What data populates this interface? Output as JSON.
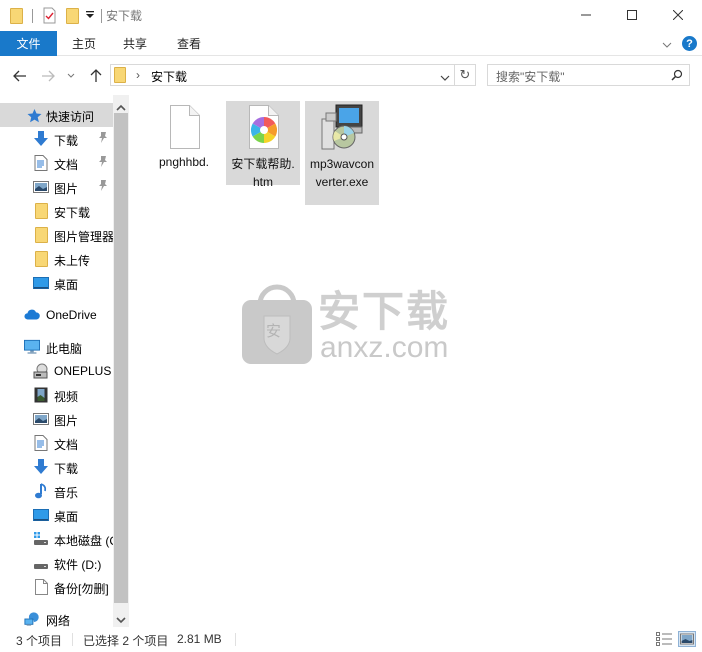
{
  "window": {
    "title": "安下载",
    "controls": {
      "minimize": "minimize",
      "maximize": "maximize",
      "close": "close"
    }
  },
  "ribbon": {
    "tabs": [
      {
        "label": "文件",
        "active": true
      },
      {
        "label": "主页",
        "active": false
      },
      {
        "label": "共享",
        "active": false
      },
      {
        "label": "查看",
        "active": false
      }
    ],
    "help_label": "?"
  },
  "address": {
    "breadcrumb": [
      "安下载"
    ],
    "search_placeholder": "搜索\"安下载\""
  },
  "sidebar": {
    "quick_access": {
      "label": "快速访问",
      "items": [
        {
          "label": "下载",
          "icon": "download-arrow-icon",
          "pinned": true
        },
        {
          "label": "文档",
          "icon": "document-icon",
          "pinned": true
        },
        {
          "label": "图片",
          "icon": "pictures-icon",
          "pinned": true
        },
        {
          "label": "安下载",
          "icon": "folder-icon",
          "pinned": false
        },
        {
          "label": "图片管理器",
          "icon": "folder-icon",
          "pinned": false
        },
        {
          "label": "未上传",
          "icon": "folder-icon",
          "pinned": false
        },
        {
          "label": "桌面",
          "icon": "desktop-icon",
          "pinned": false
        }
      ]
    },
    "onedrive": {
      "label": "OneDrive"
    },
    "this_pc": {
      "label": "此电脑",
      "items": [
        {
          "label": "ONEPLUS",
          "icon": "device-icon"
        },
        {
          "label": "视频",
          "icon": "video-icon"
        },
        {
          "label": "图片",
          "icon": "pictures-icon"
        },
        {
          "label": "文档",
          "icon": "document-icon"
        },
        {
          "label": "下载",
          "icon": "download-arrow-icon"
        },
        {
          "label": "音乐",
          "icon": "music-icon"
        },
        {
          "label": "桌面",
          "icon": "desktop-icon"
        },
        {
          "label": "本地磁盘 (C:)",
          "icon": "system-drive-icon"
        },
        {
          "label": "软件 (D:)",
          "icon": "drive-icon"
        },
        {
          "label": "备份[勿删]",
          "icon": "blank-file-icon"
        }
      ]
    },
    "network": {
      "label": "网络"
    }
  },
  "files": [
    {
      "name": "pnghhbd.",
      "type": "blank-file",
      "selected": false
    },
    {
      "name": "安下载帮助.htm",
      "type": "htm",
      "selected": true
    },
    {
      "name": "mp3wavconverter.exe",
      "type": "installer",
      "selected": true
    }
  ],
  "status": {
    "item_count": "3 个项目",
    "selection": "已选择 2 个项目",
    "size": "2.81 MB"
  },
  "watermark": {
    "text_cn": "安下载",
    "text_en": "anxz.com",
    "badge": "安"
  },
  "colors": {
    "accent": "#1979ca",
    "selected_bg": "#d9d9d9",
    "folder": "#f8d775"
  }
}
